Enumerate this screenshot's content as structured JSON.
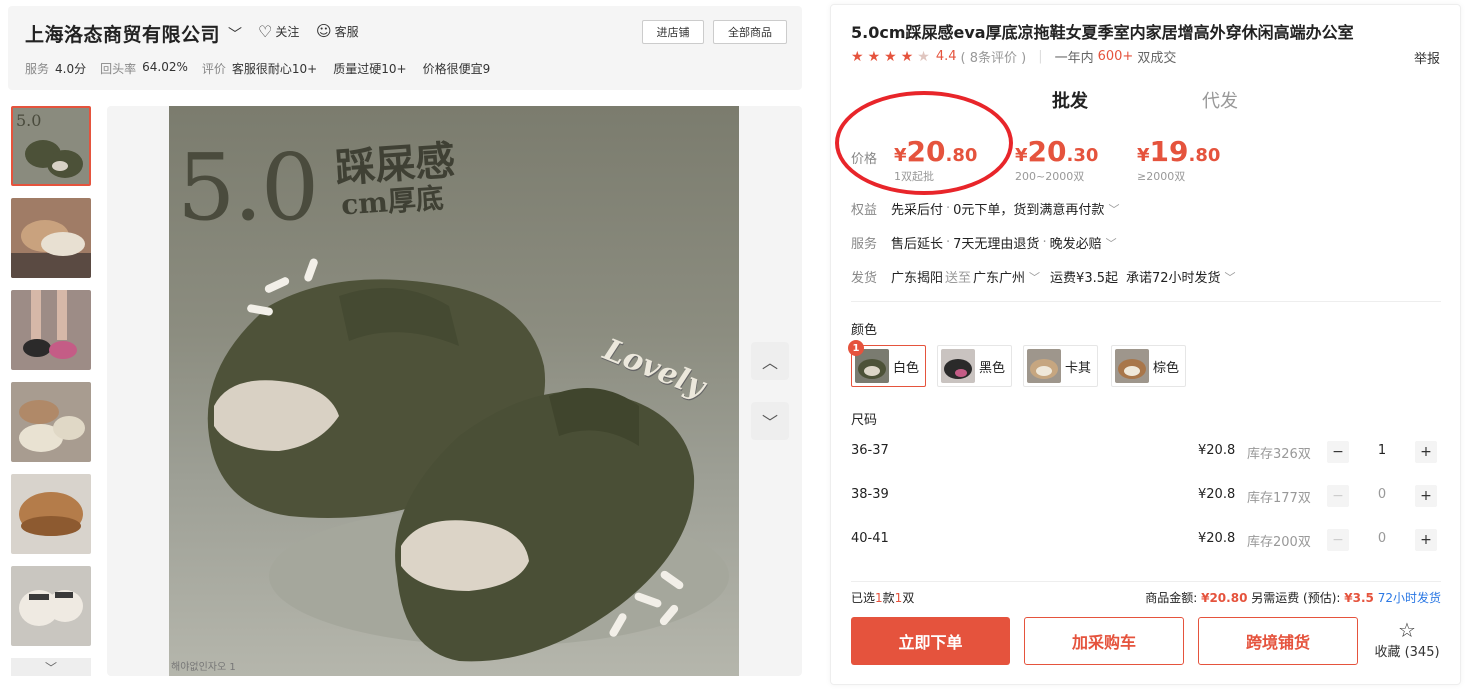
{
  "store": {
    "name": "上海洛态商贸有限公司",
    "follow_label": "关注",
    "service_label": "客服",
    "enter_store_label": "进店铺",
    "all_products_label": "全部商品",
    "metrics": [
      {
        "label": "服务",
        "value": "4.0分"
      },
      {
        "label": "回头率",
        "value": "64.02%"
      },
      {
        "label": "评价",
        "value": ""
      }
    ],
    "review_tags": [
      "客服很耐心10+",
      "质量过硬10+",
      "价格很便宜9"
    ]
  },
  "gallery": {
    "hero_number": "5.0",
    "hero_line1": "踩屎感",
    "hero_line2": "cm厚底",
    "hero_tag": "Lovely",
    "hero_credit": "해야없인자오 1"
  },
  "product": {
    "title": "5.0cm踩屎感eva厚底凉拖鞋女夏季室内家居增高外穿休闲高端办公室",
    "rating_score": "4.4",
    "rating_count": "( 8条评价 )",
    "rating_stars": 4.4,
    "sales_prefix": "一年内",
    "sales_count": "600+",
    "sales_suffix": " 双成交",
    "report_label": "举报",
    "tabs": [
      {
        "label": "批发"
      },
      {
        "label": "代发"
      }
    ],
    "price_label": "价格",
    "price_tiers": [
      {
        "yen": "¥",
        "int": "20",
        "dec": ".80",
        "condition": "1双起批"
      },
      {
        "yen": "¥",
        "int": "20",
        "dec": ".30",
        "condition": "200~2000双"
      },
      {
        "yen": "¥",
        "int": "19",
        "dec": ".80",
        "condition": "≥2000双"
      }
    ],
    "benefits": {
      "label": "权益",
      "main": "先采后付",
      "sub": "0元下单，货到满意再付款"
    },
    "service": {
      "label": "服务",
      "main": "售后延长",
      "sub": "7天无理由退货",
      "extra": "晚发必赔"
    },
    "shipping": {
      "label": "发货",
      "from": "广东揭阳",
      "to_word": "送至",
      "to": "广东广州",
      "fee": "运费¥3.5起",
      "promise": "承诺72小时发货"
    },
    "color_title": "颜色",
    "colors": [
      {
        "label": "白色",
        "badge": "1"
      },
      {
        "label": "黑色"
      },
      {
        "label": "卡其"
      },
      {
        "label": "棕色"
      }
    ],
    "size_title": "尺码",
    "sizes": [
      {
        "label": "36-37",
        "price": "¥20.8",
        "stock": "库存326双",
        "qty": "1"
      },
      {
        "label": "38-39",
        "price": "¥20.8",
        "stock": "库存177双",
        "qty": "0"
      },
      {
        "label": "40-41",
        "price": "¥20.8",
        "stock": "库存200双",
        "qty": "0"
      }
    ],
    "summary": {
      "prefix": "已选",
      "kinds": "1",
      "kinds_unit": "款",
      "pairs": "1",
      "pairs_unit": "双",
      "amount_label": "商品金额: ",
      "amount": "¥20.80",
      "shipping_label": " 另需运费 (预估): ",
      "shipping": "¥3.5",
      "ship_time": "72小时发货"
    },
    "buy_now_label": "立即下单",
    "add_cart_label": "加采购车",
    "cross_border_label": "跨境铺货",
    "favorite_label": "收藏 (345)"
  },
  "colors": {
    "accent": "#e5533d",
    "highlight_ring": "#e8252a",
    "link_blue": "#2b78e4"
  }
}
